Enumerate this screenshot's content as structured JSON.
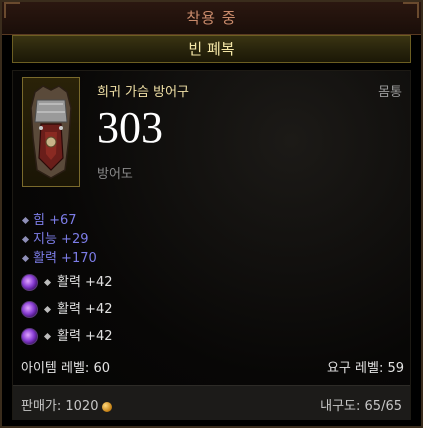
{
  "header": {
    "equipped_label": "착용 중"
  },
  "item": {
    "name": "빈 폐복",
    "type": "희귀 가슴 방어구",
    "slot": "몸통",
    "armor_value": "303",
    "armor_label": "방어도",
    "icon": "chest-armor-icon"
  },
  "stats": [
    {
      "label": "힘 +67"
    },
    {
      "label": "지능 +29"
    },
    {
      "label": "활력 +170"
    }
  ],
  "sockets": [
    {
      "label": "활력 +42",
      "icon": "purple-gem-icon"
    },
    {
      "label": "활력 +42",
      "icon": "purple-gem-icon"
    },
    {
      "label": "활력 +42",
      "icon": "purple-gem-icon"
    }
  ],
  "levels": {
    "item_level": "아이템 레벨: 60",
    "required_level": "요구 레벨: 59"
  },
  "footer": {
    "sell_label": "판매가: 1020",
    "durability": "내구도: 65/65"
  },
  "colors": {
    "item_name": "#f4e6a6",
    "stat_blue": "#7d7de8",
    "header_text": "#c98a6b"
  }
}
